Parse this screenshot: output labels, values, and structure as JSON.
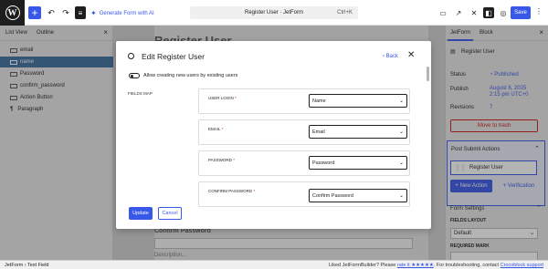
{
  "topbar": {
    "generate_label": "Generate Form with AI",
    "doc_title": "Register User · JetForm",
    "shortcut": "Ctrl+K",
    "save_label": "Save"
  },
  "left_sidebar": {
    "tabs": [
      "List View",
      "Outline"
    ],
    "items": [
      {
        "label": "email",
        "selected": false
      },
      {
        "label": "name",
        "selected": true
      },
      {
        "label": "Password",
        "selected": false
      },
      {
        "label": "confirm_password",
        "selected": false
      },
      {
        "label": "Action Button",
        "selected": false
      },
      {
        "label": "Paragraph",
        "selected": false
      }
    ]
  },
  "canvas": {
    "page_title": "Register User",
    "confirm_label": "Confirm Password",
    "description": "Description..."
  },
  "right_sidebar": {
    "tabs": [
      "JetForm",
      "Block"
    ],
    "block_title": "Register User",
    "status_label": "Status",
    "status_value": "Published",
    "publish_label": "Publish",
    "publish_value_1": "August 6, 2025",
    "publish_value_2": "2:15 pm UTC+0",
    "revisions_label": "Revisions",
    "revisions_value": "7",
    "move_trash": "Move to trash",
    "psa_title": "Post Submit Actions",
    "psa_item": "Register User",
    "new_action": "+ New Action",
    "verification": "+ Verification",
    "form_settings": "Form Settings",
    "fields_layout_label": "FIELDS LAYOUT",
    "fields_layout_value": "Default",
    "required_mark_label": "REQUIRED MARK"
  },
  "footer": {
    "breadcrumb": "JetForm  ›  Text Field",
    "notice_pre": "Liked JetFormBuilder? Please ",
    "notice_link1": "rate it ★★★★★",
    "notice_mid": ". For troubleshooting, contact ",
    "notice_link2": "Crocoblock support"
  },
  "modal": {
    "title": "Edit Register User",
    "back_label": "Back",
    "toggle_label": "Allow creating new users by existing users",
    "fields_map_label": "FIELDS MAP",
    "rows": [
      {
        "label": "USER LOGIN",
        "value": "Name"
      },
      {
        "label": "EMAIL",
        "value": "Email"
      },
      {
        "label": "PASSWORD",
        "value": "Password"
      },
      {
        "label": "CONFIRM PASSWORD",
        "value": "Confirm Password"
      }
    ],
    "update_label": "Update",
    "cancel_label": "Cancel"
  }
}
